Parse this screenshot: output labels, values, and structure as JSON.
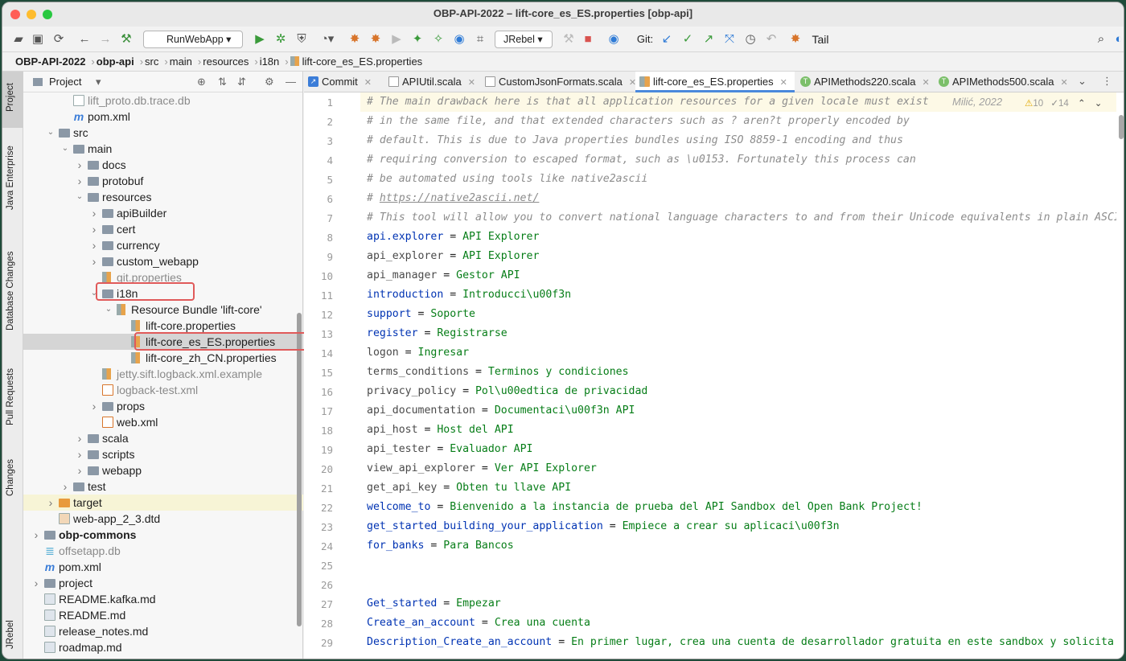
{
  "window": {
    "title": "OBP-API-2022 – lift-core_es_ES.properties [obp-api]"
  },
  "toolbar": {
    "run_config": "RunWebApp",
    "jrebel": "JRebel",
    "git_label": "Git:",
    "tail_label": "Tail"
  },
  "breadcrumb": [
    "OBP-API-2022",
    "obp-api",
    "src",
    "main",
    "resources",
    "i18n",
    "lift-core_es_ES.properties"
  ],
  "left_tabs": [
    "Project",
    "Java Enterprise",
    "Database Changes",
    "Pull Requests",
    "Changes",
    "JRebel"
  ],
  "project_panel": {
    "title": "Project"
  },
  "tree": [
    {
      "label": "lift_proto.db.trace.db",
      "depth": 3,
      "type": "file",
      "dim": true
    },
    {
      "label": "pom.xml",
      "depth": 3,
      "type": "maven"
    },
    {
      "label": "src",
      "depth": 2,
      "type": "folder",
      "arrow": "open"
    },
    {
      "label": "main",
      "depth": 3,
      "type": "folder",
      "arrow": "open"
    },
    {
      "label": "docs",
      "depth": 4,
      "type": "folder",
      "arrow": "closed"
    },
    {
      "label": "protobuf",
      "depth": 4,
      "type": "folder",
      "arrow": "closed"
    },
    {
      "label": "resources",
      "depth": 4,
      "type": "folder",
      "arrow": "open"
    },
    {
      "label": "apiBuilder",
      "depth": 5,
      "type": "folder",
      "arrow": "closed"
    },
    {
      "label": "cert",
      "depth": 5,
      "type": "folder",
      "arrow": "closed"
    },
    {
      "label": "currency",
      "depth": 5,
      "type": "folder",
      "arrow": "closed"
    },
    {
      "label": "custom_webapp",
      "depth": 5,
      "type": "folder",
      "arrow": "closed"
    },
    {
      "label": "git.properties",
      "depth": 5,
      "type": "props",
      "dim": true
    },
    {
      "label": "i18n",
      "depth": 5,
      "type": "folder",
      "arrow": "open"
    },
    {
      "label": "Resource Bundle 'lift-core'",
      "depth": 6,
      "type": "props",
      "arrow": "open"
    },
    {
      "label": "lift-core.properties",
      "depth": 7,
      "type": "props"
    },
    {
      "label": "lift-core_es_ES.properties",
      "depth": 7,
      "type": "props",
      "selected": true
    },
    {
      "label": "lift-core_zh_CN.properties",
      "depth": 7,
      "type": "props"
    },
    {
      "label": "jetty.sift.logback.xml.example",
      "depth": 5,
      "type": "props",
      "dim": true
    },
    {
      "label": "logback-test.xml",
      "depth": 5,
      "type": "xml",
      "dim": true
    },
    {
      "label": "props",
      "depth": 5,
      "type": "folder",
      "arrow": "closed"
    },
    {
      "label": "web.xml",
      "depth": 5,
      "type": "xml"
    },
    {
      "label": "scala",
      "depth": 4,
      "type": "folder",
      "arrow": "closed"
    },
    {
      "label": "scripts",
      "depth": 4,
      "type": "folder",
      "arrow": "closed"
    },
    {
      "label": "webapp",
      "depth": 4,
      "type": "folder",
      "arrow": "closed"
    },
    {
      "label": "test",
      "depth": 3,
      "type": "folder",
      "arrow": "closed"
    },
    {
      "label": "target",
      "depth": 2,
      "type": "folder-orange",
      "arrow": "closed",
      "highlight": true
    },
    {
      "label": "web-app_2_3.dtd",
      "depth": 2,
      "type": "dtd"
    },
    {
      "label": "obp-commons",
      "depth": 1,
      "type": "folder",
      "arrow": "closed",
      "bold": true
    },
    {
      "label": "offsetapp.db",
      "depth": 1,
      "type": "db",
      "dim": true
    },
    {
      "label": "pom.xml",
      "depth": 1,
      "type": "maven"
    },
    {
      "label": "project",
      "depth": 1,
      "type": "folder",
      "arrow": "closed"
    },
    {
      "label": "README.kafka.md",
      "depth": 1,
      "type": "md"
    },
    {
      "label": "README.md",
      "depth": 1,
      "type": "md"
    },
    {
      "label": "release_notes.md",
      "depth": 1,
      "type": "md"
    },
    {
      "label": "roadmap.md",
      "depth": 1,
      "type": "md"
    }
  ],
  "editor_tabs": [
    {
      "label": "Commit",
      "icon": "commit"
    },
    {
      "label": "APIUtil.scala",
      "icon": "scala"
    },
    {
      "label": "CustomJsonFormats.scala",
      "icon": "scala"
    },
    {
      "label": "lift-core_es_ES.properties",
      "icon": "props",
      "active": true
    },
    {
      "label": "APIMethods220.scala",
      "icon": "scala-t"
    },
    {
      "label": "APIMethods500.scala",
      "icon": "scala-t"
    }
  ],
  "editor_meta": {
    "author": "Milić, 2022",
    "warnings": "10",
    "checks": "14"
  },
  "code": [
    {
      "t": "c",
      "text": "# The main drawback here is that all application resources for a given locale must exist"
    },
    {
      "t": "c",
      "text": "# in the same file, and that extended characters such as ? aren?t properly encoded by"
    },
    {
      "t": "c",
      "text": "# default. This is due to Java properties bundles using ISO 8859-1 encoding and thus"
    },
    {
      "t": "c",
      "text": "# requiring conversion to escaped format, such as \\u0153. Fortunately this process can"
    },
    {
      "t": "c",
      "text": "# be automated using tools like native2ascii"
    },
    {
      "t": "l",
      "pre": "# ",
      "link": "https://native2ascii.net/"
    },
    {
      "t": "c",
      "text": "# This tool will allow you to convert national language characters to and from their Unicode equivalents in plain ASCII"
    },
    {
      "t": "kv",
      "k": "api.explorer",
      "v": "API Explorer",
      "strong": true
    },
    {
      "t": "kv",
      "k": "api_explorer",
      "v": "API Explorer"
    },
    {
      "t": "kv",
      "k": "api_manager",
      "v": "Gestor API"
    },
    {
      "t": "kv",
      "k": "introduction",
      "v": "Introducci\\u00f3n",
      "strong": true
    },
    {
      "t": "kv",
      "k": "support",
      "v": "Soporte",
      "strong": true
    },
    {
      "t": "kv",
      "k": "register",
      "v": "Registrarse",
      "strong": true
    },
    {
      "t": "kv",
      "k": "logon",
      "v": "Ingresar"
    },
    {
      "t": "kv",
      "k": "terms_conditions",
      "v": "Terminos y condiciones"
    },
    {
      "t": "kv",
      "k": "privacy_policy",
      "v": "Pol\\u00edtica de privacidad"
    },
    {
      "t": "kv",
      "k": "api_documentation",
      "v": "Documentaci\\u00f3n API"
    },
    {
      "t": "kv",
      "k": "api_host",
      "v": "Host del API"
    },
    {
      "t": "kv",
      "k": "api_tester",
      "v": "Evaluador API"
    },
    {
      "t": "kv",
      "k": "view_api_explorer",
      "v": "Ver API Explorer"
    },
    {
      "t": "kv",
      "k": "get_api_key",
      "v": "Obten tu llave API"
    },
    {
      "t": "kv",
      "k": "welcome_to",
      "v": "Bienvenido a la instancia de prueba del API Sandbox del Open Bank Project!",
      "strong": true
    },
    {
      "t": "kv",
      "k": "get_started_building_your_application",
      "v": "Empiece a crear su aplicaci\\u00f3n",
      "strong": true
    },
    {
      "t": "kv",
      "k": "for_banks",
      "v": "Para Bancos",
      "strong": true
    },
    {
      "t": "e"
    },
    {
      "t": "e"
    },
    {
      "t": "kv",
      "k": "Get_started",
      "v": "Empezar",
      "strong": true
    },
    {
      "t": "kv",
      "k": "Create_an_account",
      "v": "Crea una cuenta",
      "strong": true
    },
    {
      "t": "kv",
      "k": "Description_Create_an_account",
      "v": "En primer lugar, crea una cuenta de desarrollador gratuita en este sandbox y solicita una llave",
      "strong": true
    }
  ]
}
